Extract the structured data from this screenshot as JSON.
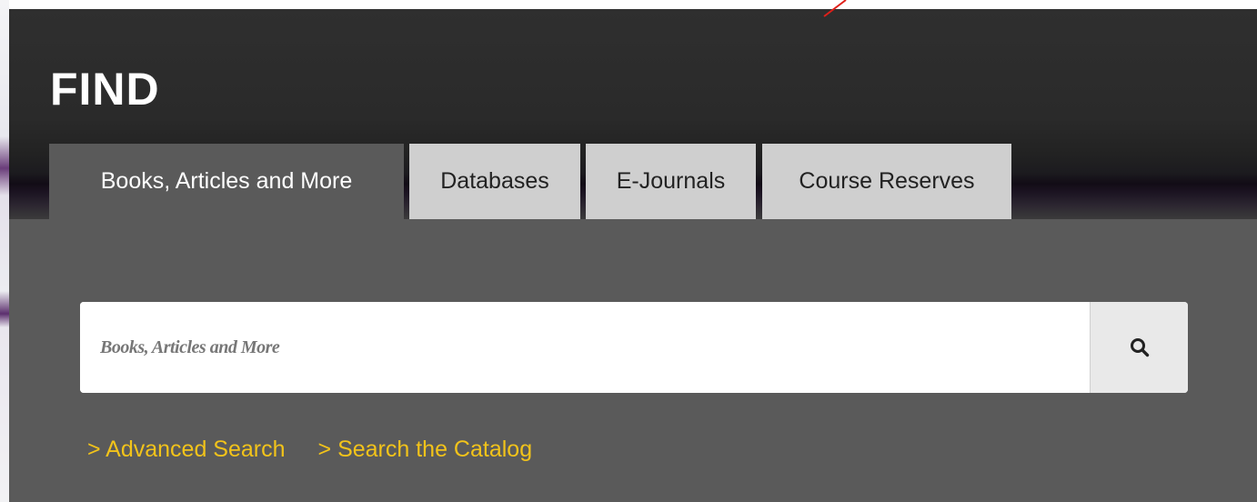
{
  "header": {
    "title": "FIND"
  },
  "tabs": [
    {
      "label": "Books, Articles and More",
      "active": true
    },
    {
      "label": "Databases",
      "active": false
    },
    {
      "label": "E-Journals",
      "active": false
    },
    {
      "label": "Course Reserves",
      "active": false
    }
  ],
  "search": {
    "placeholder": "Books, Articles and More",
    "value": "",
    "button_icon": "search-icon"
  },
  "links": [
    {
      "label": "> Advanced Search"
    },
    {
      "label": "> Search the Catalog"
    }
  ],
  "colors": {
    "panel": "#5a5a5a",
    "tab_inactive": "#cfcfcf",
    "link": "#f2c31a",
    "annotation": "#e0201a"
  }
}
